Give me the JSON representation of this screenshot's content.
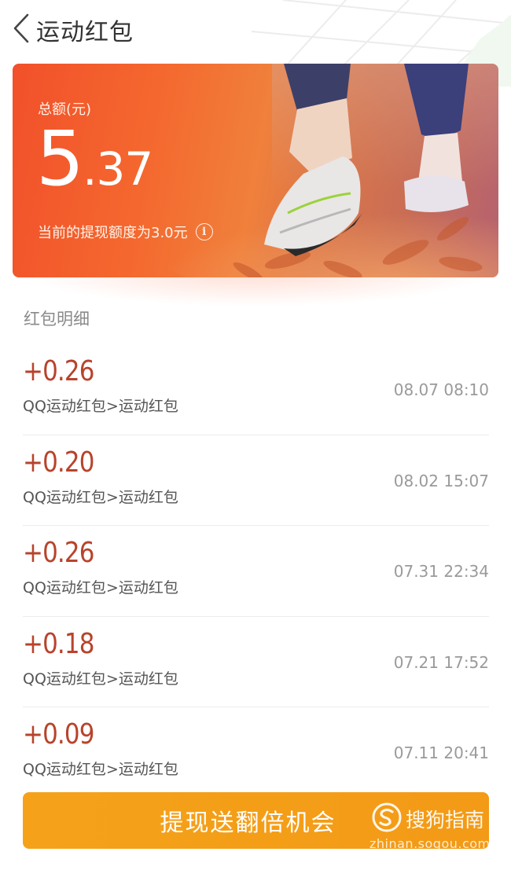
{
  "header": {
    "title": "运动红包",
    "back_icon": "chevron-left-icon"
  },
  "banner": {
    "total_label": "总额(元)",
    "total_integer": "5",
    "total_decimal": ".37",
    "limit_text": "当前的提现额度为3.0元",
    "info_icon": "i",
    "colors": {
      "start": "#f2502a",
      "end": "#b56270"
    }
  },
  "details": {
    "section_title": "红包明细",
    "items": [
      {
        "amount": "+0.26",
        "source": "QQ运动红包>运动红包",
        "time": "08.07 08:10"
      },
      {
        "amount": "+0.20",
        "source": "QQ运动红包>运动红包",
        "time": "08.02 15:07"
      },
      {
        "amount": "+0.26",
        "source": "QQ运动红包>运动红包",
        "time": "07.31 22:34"
      },
      {
        "amount": "+0.18",
        "source": "QQ运动红包>运动红包",
        "time": "07.21 17:52"
      },
      {
        "amount": "+0.09",
        "source": "QQ运动红包>运动红包",
        "time": "07.11 20:41"
      }
    ],
    "amount_color": "#b8432c"
  },
  "cta": {
    "label": "提现送翻倍机会",
    "color": "#f5a21a"
  },
  "watermark": {
    "brand": "搜狗指南",
    "url": "zhinan.sogou.com"
  }
}
